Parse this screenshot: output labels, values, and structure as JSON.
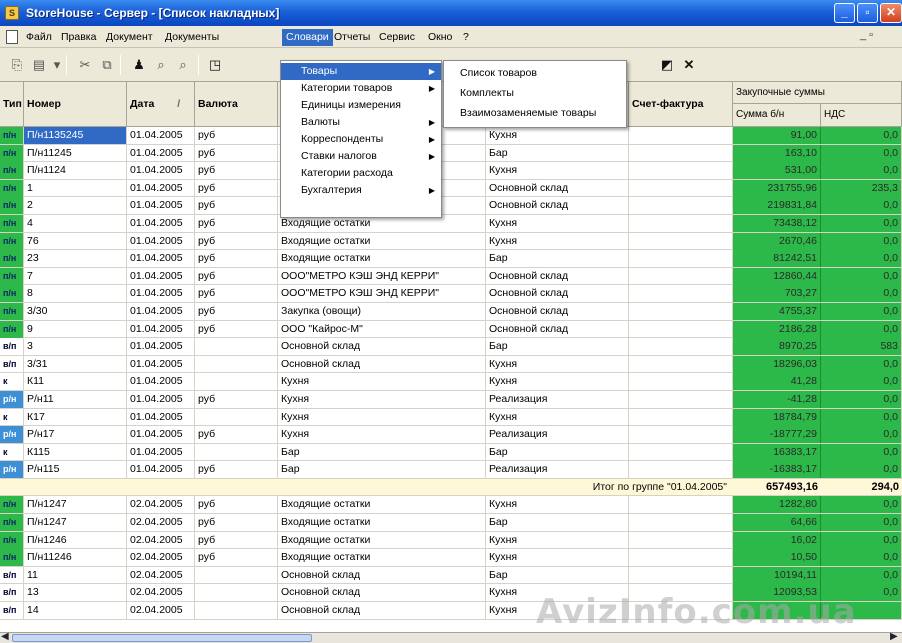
{
  "window": {
    "title": "StoreHouse - Сервер - [Список накладных]",
    "app_icon_glyph": "S",
    "min_glyph": "_",
    "max_glyph": "▫",
    "close_glyph": "✕",
    "colors": {
      "titlebar": "#1a5fd8",
      "grid_green": "#2db84a",
      "selection": "#316ac5"
    }
  },
  "menubar": {
    "items": [
      "Файл",
      "Правка",
      "Документ",
      "Документы",
      "Словари",
      "Отчеты",
      "Сервис",
      "Окно",
      "?"
    ],
    "active": "Словари",
    "mdi_controls": "_ ▫"
  },
  "toolbar": {
    "icons": [
      "copy-icon",
      "paste-icon",
      "dropdown-icon",
      "cut-icon",
      "paste-special-icon",
      "binoculars-icon",
      "find-icon",
      "find-next-icon",
      "view-icon",
      "properties-icon",
      "close-x-icon"
    ],
    "glyphs": [
      "⎘",
      "▤",
      "▾",
      "✂",
      "⧉",
      "♟",
      "⌕",
      "⌕",
      "◳",
      "◩",
      "✕"
    ]
  },
  "dropdown": {
    "items": [
      {
        "label": "Товары",
        "submenu": true,
        "highlighted": true
      },
      {
        "label": "Категории товаров",
        "submenu": true
      },
      {
        "label": "Единицы измерения",
        "submenu": false
      },
      {
        "label": "Валюты",
        "submenu": true
      },
      {
        "label": "Корреспонденты",
        "submenu": true
      },
      {
        "label": "Ставки налогов",
        "submenu": true
      },
      {
        "label": "Категории расхода",
        "submenu": false
      },
      {
        "label": "Бухгалтерия",
        "submenu": true
      }
    ],
    "submenu_arrow": "▶",
    "submenu": [
      "Список товаров",
      "Комплекты",
      "Взаимозаменяемые товары"
    ]
  },
  "columns": {
    "type": "Тип",
    "number": "Номер",
    "date": "Дата",
    "date_sort": "/",
    "currency": "Валюта",
    "invoice": "Счет-фактура",
    "purchase_group": "Закупочные суммы",
    "sum_no_vat": "Сумма б/н",
    "vat": "НДС"
  },
  "rows": [
    {
      "type": "п/н",
      "num": "П/н1135245",
      "date": "01.04.2005",
      "cur": "руб",
      "sup": "",
      "rec": "Кухня",
      "inv": "",
      "sum": "91,00",
      "vat": "0,0",
      "sel": true
    },
    {
      "type": "п/н",
      "num": "П/н11245",
      "date": "01.04.2005",
      "cur": "руб",
      "sup": "",
      "rec": "Бар",
      "inv": "",
      "sum": "163,10",
      "vat": "0,0"
    },
    {
      "type": "п/н",
      "num": "П/н1124",
      "date": "01.04.2005",
      "cur": "руб",
      "sup": "",
      "rec": "Кухня",
      "inv": "",
      "sum": "531,00",
      "vat": "0,0"
    },
    {
      "type": "п/н",
      "num": "1",
      "date": "01.04.2005",
      "cur": "руб",
      "sup": "",
      "rec": "Основной склад",
      "inv": "",
      "sum": "231755,96",
      "vat": "235,3"
    },
    {
      "type": "п/н",
      "num": "2",
      "date": "01.04.2005",
      "cur": "руб",
      "sup": "",
      "rec": "Основной склад",
      "inv": "",
      "sum": "219831,84",
      "vat": "0,0"
    },
    {
      "type": "п/н",
      "num": "4",
      "date": "01.04.2005",
      "cur": "руб",
      "sup": "Входящие остатки",
      "rec": "Кухня",
      "inv": "",
      "sum": "73438,12",
      "vat": "0,0"
    },
    {
      "type": "п/н",
      "num": "76",
      "date": "01.04.2005",
      "cur": "руб",
      "sup": "Входящие остатки",
      "rec": "Кухня",
      "inv": "",
      "sum": "2670,46",
      "vat": "0,0"
    },
    {
      "type": "п/н",
      "num": "23",
      "date": "01.04.2005",
      "cur": "руб",
      "sup": "Входящие остатки",
      "rec": "Бар",
      "inv": "",
      "sum": "81242,51",
      "vat": "0,0"
    },
    {
      "type": "п/н",
      "num": "7",
      "date": "01.04.2005",
      "cur": "руб",
      "sup": "ООО\"МЕТРО КЭШ ЭНД КЕРРИ\"",
      "rec": "Основной склад",
      "inv": "",
      "sum": "12860,44",
      "vat": "0,0"
    },
    {
      "type": "п/н",
      "num": "8",
      "date": "01.04.2005",
      "cur": "руб",
      "sup": "ООО\"МЕТРО КЭШ ЭНД КЕРРИ\"",
      "rec": "Основной склад",
      "inv": "",
      "sum": "703,27",
      "vat": "0,0"
    },
    {
      "type": "п/н",
      "num": "3/30",
      "date": "01.04.2005",
      "cur": "руб",
      "sup": "Закупка (овощи)",
      "rec": "Основной склад",
      "inv": "",
      "sum": "4755,37",
      "vat": "0,0"
    },
    {
      "type": "п/н",
      "num": "9",
      "date": "01.04.2005",
      "cur": "руб",
      "sup": "ООО \"Кайрос-М\"",
      "rec": "Основной склад",
      "inv": "",
      "sum": "2186,28",
      "vat": "0,0"
    },
    {
      "type": "в/п",
      "num": "3",
      "date": "01.04.2005",
      "cur": "",
      "sup": "Основной склад",
      "rec": "Бар",
      "inv": "",
      "sum": "8970,25",
      "vat": "583"
    },
    {
      "type": "в/п",
      "num": "3/31",
      "date": "01.04.2005",
      "cur": "",
      "sup": "Основной склад",
      "rec": "Кухня",
      "inv": "",
      "sum": "18296,03",
      "vat": "0,0"
    },
    {
      "type": "к",
      "num": "К11",
      "date": "01.04.2005",
      "cur": "",
      "sup": "Кухня",
      "rec": "Кухня",
      "inv": "",
      "sum": "41,28",
      "vat": "0,0"
    },
    {
      "type": "р/н",
      "num": "Р/н11",
      "date": "01.04.2005",
      "cur": "руб",
      "sup": "Кухня",
      "rec": "Реализация",
      "inv": "",
      "sum": "-41,28",
      "vat": "0,0"
    },
    {
      "type": "к",
      "num": "К17",
      "date": "01.04.2005",
      "cur": "",
      "sup": "Кухня",
      "rec": "Кухня",
      "inv": "",
      "sum": "18784,79",
      "vat": "0,0"
    },
    {
      "type": "р/н",
      "num": "Р/н17",
      "date": "01.04.2005",
      "cur": "руб",
      "sup": "Кухня",
      "rec": "Реализация",
      "inv": "",
      "sum": "-18777,29",
      "vat": "0,0"
    },
    {
      "type": "к",
      "num": "К115",
      "date": "01.04.2005",
      "cur": "",
      "sup": "Бар",
      "rec": "Бар",
      "inv": "",
      "sum": "16383,17",
      "vat": "0,0"
    },
    {
      "type": "р/н",
      "num": "Р/н115",
      "date": "01.04.2005",
      "cur": "руб",
      "sup": "Бар",
      "rec": "Реализация",
      "inv": "",
      "sum": "-16383,17",
      "vat": "0,0"
    },
    {
      "total": true,
      "label": "Итог по группе \"01.04.2005\"",
      "sum": "657493,16",
      "vat": "294,0"
    },
    {
      "type": "п/н",
      "num": "П/н1247",
      "date": "02.04.2005",
      "cur": "руб",
      "sup": "Входящие остатки",
      "rec": "Кухня",
      "inv": "",
      "sum": "1282,80",
      "vat": "0,0"
    },
    {
      "type": "п/н",
      "num": "П/н1247",
      "date": "02.04.2005",
      "cur": "руб",
      "sup": "Входящие остатки",
      "rec": "Бар",
      "inv": "",
      "sum": "64,66",
      "vat": "0,0"
    },
    {
      "type": "п/н",
      "num": "П/н1246",
      "date": "02.04.2005",
      "cur": "руб",
      "sup": "Входящие остатки",
      "rec": "Кухня",
      "inv": "",
      "sum": "16,02",
      "vat": "0,0"
    },
    {
      "type": "п/н",
      "num": "П/н11246",
      "date": "02.04.2005",
      "cur": "руб",
      "sup": "Входящие остатки",
      "rec": "Кухня",
      "inv": "",
      "sum": "10,50",
      "vat": "0,0"
    },
    {
      "type": "в/п",
      "num": "11",
      "date": "02.04.2005",
      "cur": "",
      "sup": "Основной склад",
      "rec": "Бар",
      "inv": "",
      "sum": "10194,11",
      "vat": "0,0"
    },
    {
      "type": "в/п",
      "num": "13",
      "date": "02.04.2005",
      "cur": "",
      "sup": "Основной склад",
      "rec": "Кухня",
      "inv": "",
      "sum": "12093,53",
      "vat": "0,0"
    },
    {
      "type": "в/п",
      "num": "14",
      "date": "02.04.2005",
      "cur": "",
      "sup": "Основной склад",
      "rec": "Кухня",
      "inv": "",
      "sum": "",
      "vat": ""
    }
  ],
  "scroll": {
    "left_arrow": "◀",
    "right_arrow": "▶"
  },
  "watermark": "AvizInfo.com.ua"
}
